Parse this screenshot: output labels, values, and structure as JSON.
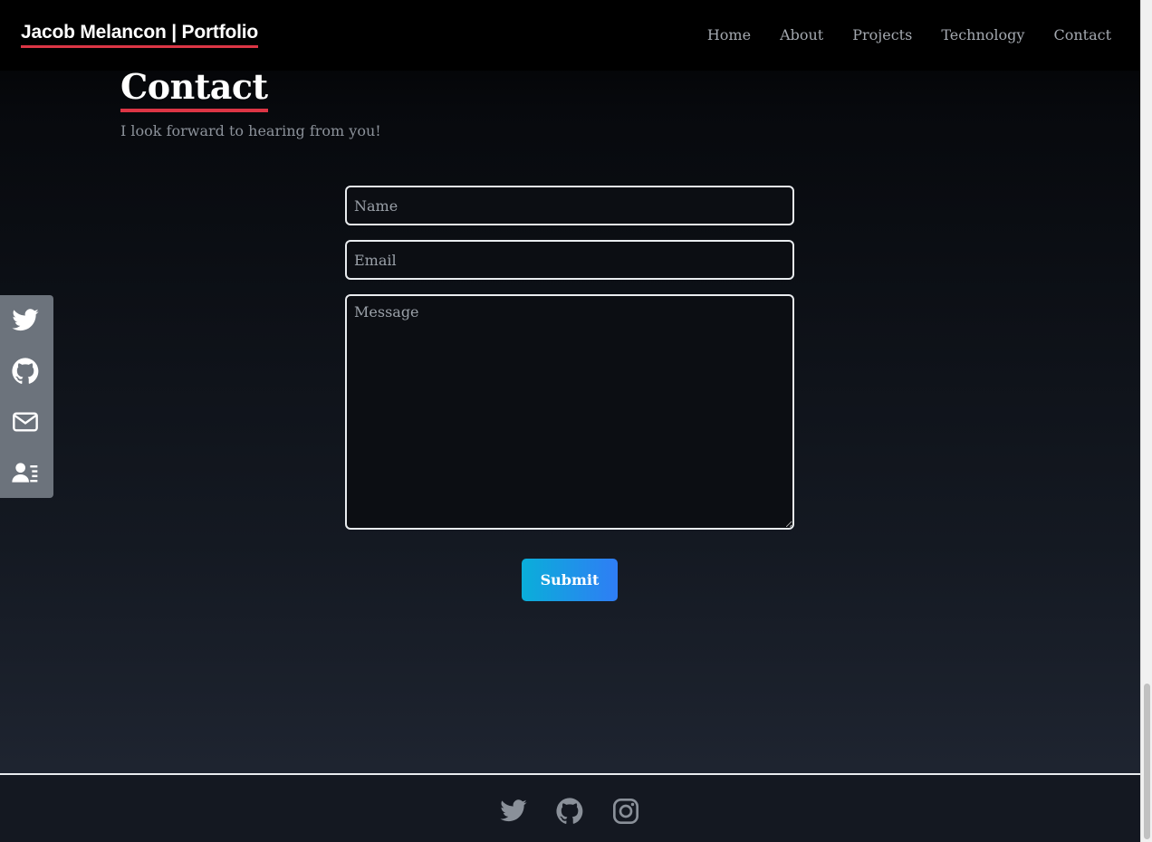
{
  "navbar": {
    "brand": "Jacob Melancon | Portfolio",
    "links": [
      "Home",
      "About",
      "Projects",
      "Technology",
      "Contact"
    ]
  },
  "contact": {
    "title": "Contact",
    "subtitle": "I look forward to hearing from you!",
    "form": {
      "name_placeholder": "Name",
      "email_placeholder": "Email",
      "message_placeholder": "Message",
      "submit_label": "Submit"
    }
  },
  "side_bar": {
    "icons": [
      "twitter-icon",
      "github-icon",
      "mail-icon",
      "resume-icon"
    ]
  },
  "footer": {
    "icons": [
      "twitter-icon",
      "github-icon",
      "instagram-icon"
    ]
  },
  "colors": {
    "accent_underline": "#dc3545",
    "submit_gradient_start": "#0aaed9",
    "submit_gradient_end": "#2f7df5",
    "nav_text": "#a4a9b0",
    "side_bar_bg": "#6c737c"
  }
}
